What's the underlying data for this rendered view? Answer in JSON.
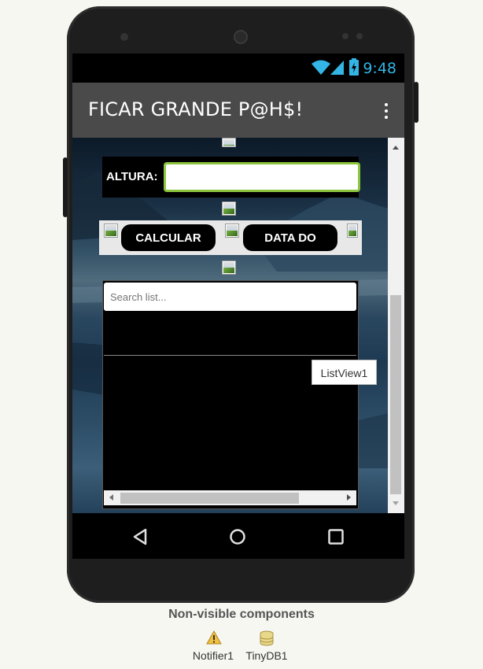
{
  "status_bar": {
    "time": "9:48"
  },
  "app_bar": {
    "title": "FICAR GRANDE P@H$!"
  },
  "form": {
    "altura_label": "ALTURA:",
    "altura_value": "",
    "calcular_label": "CALCULAR",
    "data_label": "DATA DO"
  },
  "list": {
    "search_placeholder": "Search list...",
    "component_label": "ListView1"
  },
  "nonvisible": {
    "heading": "Non-visible components",
    "items": [
      {
        "name": "Notifier1",
        "icon": "warning-icon"
      },
      {
        "name": "TinyDB1",
        "icon": "database-icon"
      }
    ]
  },
  "colors": {
    "status_accent": "#33b5e5",
    "app_bar": "#4a4a4a",
    "textbox_border": "#8cc63f"
  }
}
